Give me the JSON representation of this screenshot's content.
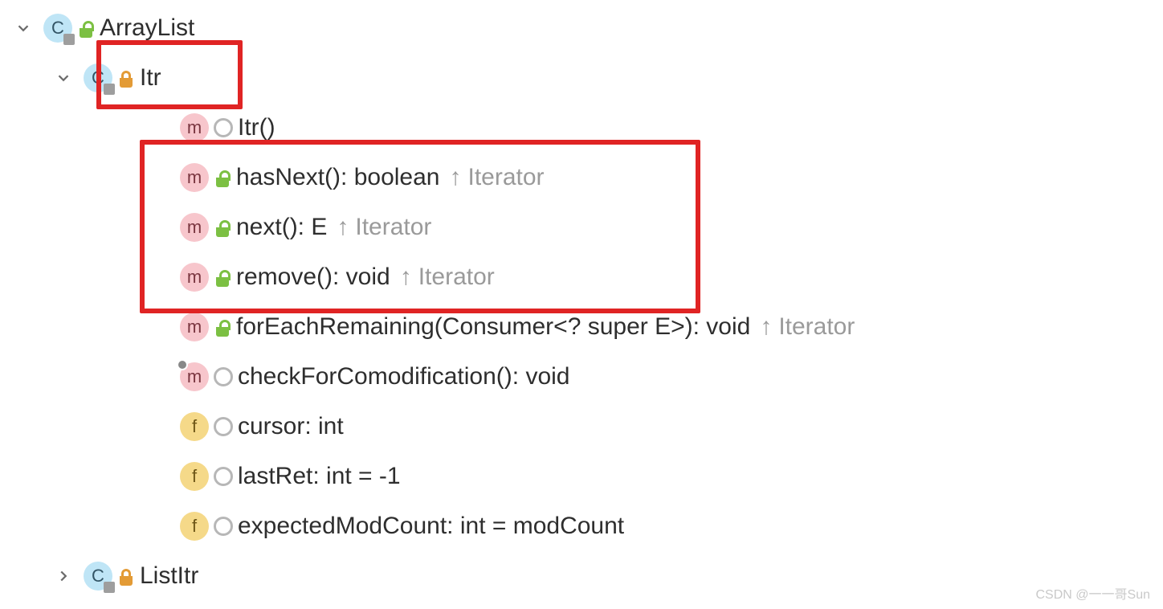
{
  "tree": {
    "root": {
      "name": "ArrayList",
      "kind": "c",
      "access": "green-open"
    },
    "child1": {
      "name": "Itr",
      "kind": "c",
      "access": "orange"
    },
    "members": [
      {
        "kind": "m",
        "mod": "odot",
        "label": "Itr()",
        "inherit": ""
      },
      {
        "kind": "m",
        "mod": "green",
        "label": "hasNext(): boolean",
        "inherit": "Iterator"
      },
      {
        "kind": "m",
        "mod": "green",
        "label": "next(): E",
        "inherit": "Iterator"
      },
      {
        "kind": "m",
        "mod": "green",
        "label": "remove(): void",
        "inherit": "Iterator"
      },
      {
        "kind": "m",
        "mod": "green",
        "label": "forEachRemaining(Consumer<? super E>): void",
        "inherit": "Iterator"
      },
      {
        "kind": "m",
        "mod": "odot",
        "label": "checkForComodification(): void",
        "inherit": "",
        "pin": true
      },
      {
        "kind": "f",
        "mod": "odot",
        "label": "cursor: int",
        "inherit": ""
      },
      {
        "kind": "f",
        "mod": "odot",
        "label": "lastRet: int = -1",
        "inherit": ""
      },
      {
        "kind": "f",
        "mod": "odot",
        "label": "expectedModCount: int = modCount",
        "inherit": ""
      }
    ],
    "child2": {
      "name": "ListItr",
      "kind": "c",
      "access": "orange"
    }
  },
  "watermark": "CSDN @一一哥Sun"
}
